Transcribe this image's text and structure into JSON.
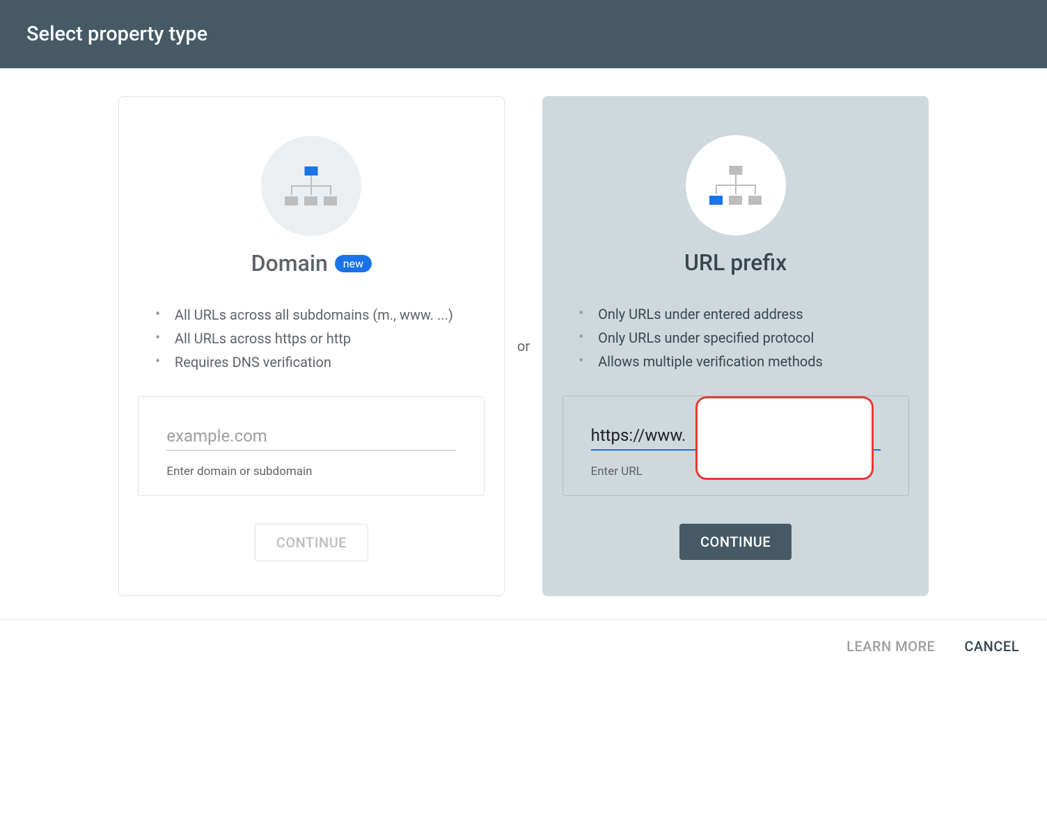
{
  "header": {
    "title": "Select property type"
  },
  "divider": "or",
  "domain_card": {
    "title": "Domain",
    "badge": "new",
    "features": [
      "All URLs across all subdomains (m., www. ...)",
      "All URLs across https or http",
      "Requires DNS verification"
    ],
    "input_placeholder": "example.com",
    "input_value": "",
    "input_label": "Enter domain or subdomain",
    "button": "CONTINUE"
  },
  "url_card": {
    "title": "URL prefix",
    "features": [
      "Only URLs under entered address",
      "Only URLs under specified protocol",
      "Allows multiple verification methods"
    ],
    "input_value": "https://www.",
    "input_label": "Enter URL",
    "button": "CONTINUE"
  },
  "footer": {
    "learn_more": "LEARN MORE",
    "cancel": "CANCEL"
  },
  "colors": {
    "header_bg": "#455a64",
    "accent": "#1a73e8",
    "selected_card_bg": "#cfd8dc",
    "redaction_border": "#e53935"
  }
}
